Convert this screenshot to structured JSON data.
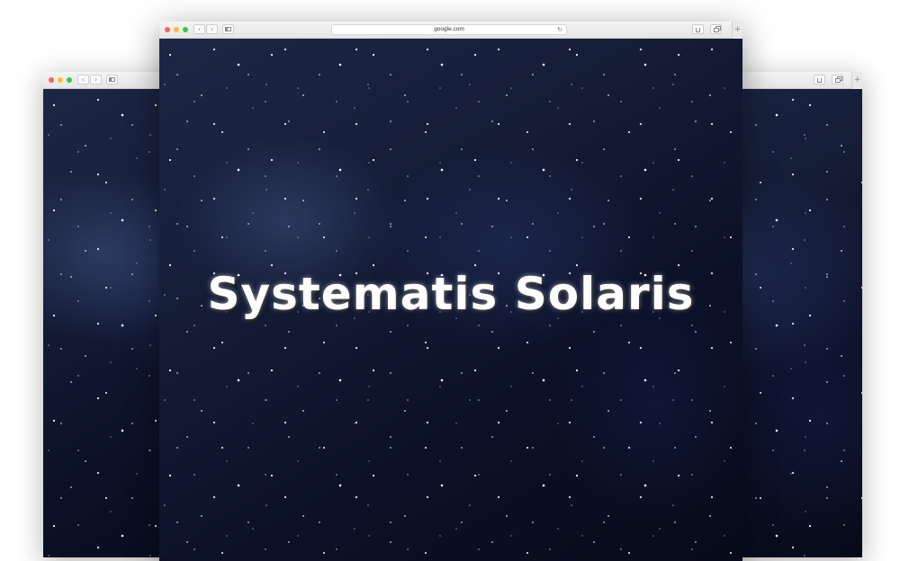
{
  "browser": {
    "url": "google.com",
    "icons": {
      "back": "chevron-left-icon",
      "forward": "chevron-right-icon",
      "sidebar": "sidebar-icon",
      "reload": "reload-icon",
      "share": "share-icon",
      "tabs": "tabs-overview-icon",
      "new_tab": "plus-icon"
    },
    "colors": {
      "close": "#fc605c",
      "minimize": "#fdbc40",
      "zoom": "#34c84a"
    }
  },
  "page": {
    "title": "Systematis Solaris",
    "background": "starfield"
  }
}
